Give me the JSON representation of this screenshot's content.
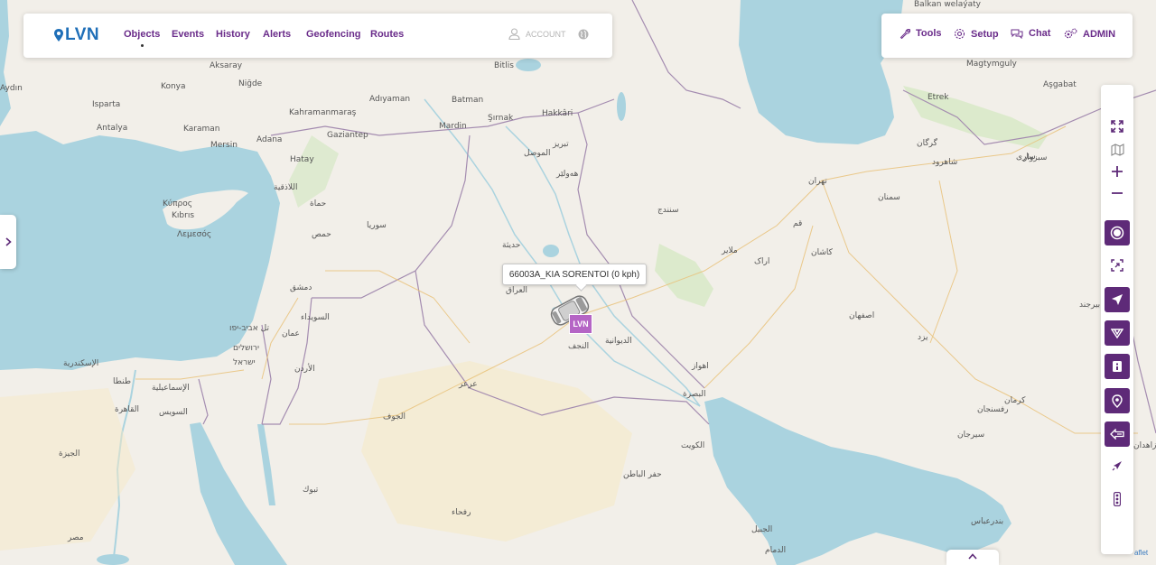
{
  "app": {
    "logo_text": "LVN",
    "brand_color": "#1f6fb8",
    "accent_color": "#6a2c8a",
    "toolbar_fill_color": "#5e2a78"
  },
  "nav": {
    "items": [
      {
        "label": "Objects",
        "active": true
      },
      {
        "label": "Events"
      },
      {
        "label": "History"
      },
      {
        "label": "Alerts"
      },
      {
        "label": "Geofencing"
      },
      {
        "label": "Routes"
      }
    ],
    "account_label": "ACCOUNT",
    "globe_icon": "globe-icon"
  },
  "top_right": {
    "tools_label": "Tools",
    "setup_label": "Setup",
    "chat_label": "Chat",
    "admin_label": "ADMIN"
  },
  "toolbar": {
    "buttons": [
      {
        "icon": "fullscreen-icon",
        "filled": false
      },
      {
        "icon": "map-layers-icon",
        "filled": false
      },
      {
        "icon": "zoom-in-icon",
        "filled": false
      },
      {
        "icon": "zoom-out-icon",
        "filled": false
      },
      {
        "icon": "objects-toggle-icon",
        "filled": true
      },
      {
        "icon": "fit-bounds-icon",
        "filled": false
      },
      {
        "icon": "navigation-arrow-icon",
        "filled": true
      },
      {
        "icon": "route-icon",
        "filled": true
      },
      {
        "icon": "info-card-icon",
        "filled": true
      },
      {
        "icon": "location-pin-icon",
        "filled": true
      },
      {
        "icon": "street-view-icon",
        "filled": true
      },
      {
        "icon": "draw-pen-icon",
        "filled": false
      },
      {
        "icon": "traffic-light-icon",
        "filled": false
      }
    ]
  },
  "map": {
    "attribution": "aflet",
    "object_tooltip": "66003A_KIA SORENTOI (0 kph)",
    "object_marker_label": "LVN",
    "labels": [
      "Aksaray",
      "Niğde",
      "Adana",
      "Gaziantep",
      "Adıyaman",
      "Batman",
      "Mardin",
      "Şırnak",
      "Hakkâri",
      "Bitlis",
      "Antalya",
      "Isparta",
      "Aydın",
      "Karaman",
      "Kahramanmaraş",
      "Konya",
      "Mersin",
      "Hatay",
      "Κύπρος",
      "Kıbrıs",
      "Λεμεσός",
      "Magtymguly",
      "Etrek",
      "Aşgabat",
      "Balkan welaýaty",
      "الموصل",
      "هەولێر",
      "سوريا",
      "حمص",
      "حماة",
      "اللاذقية",
      "دمشق",
      "السويداء",
      "عمان",
      "الأردن",
      "العراق",
      "النجف",
      "الديوانية",
      "البصرة",
      "الكويت",
      "حديثة",
      "تل אביב-יפו",
      "ירושלים",
      "ישראל",
      "القاهرة",
      "الإسماعيلية",
      "السويس",
      "الإسكندرية",
      "طنطا",
      "الجيزة",
      "مصر",
      "تبوك",
      "الجوف",
      "عرعر",
      "رفحاء",
      "حفر الباطن",
      "الدمام",
      "الجبيل",
      "تهران",
      "قم",
      "کاشان",
      "اصفهان",
      "یزد",
      "کرمان",
      "رفسنجان",
      "سیرجان",
      "بندرعباس",
      "زاهدان",
      "سمنان",
      "ساری",
      "گرگان",
      "اراک",
      "سنندج",
      "ملایر",
      "اهواز",
      "بیرجند",
      "تبريز",
      "شاهرود",
      "سبزوار"
    ]
  }
}
